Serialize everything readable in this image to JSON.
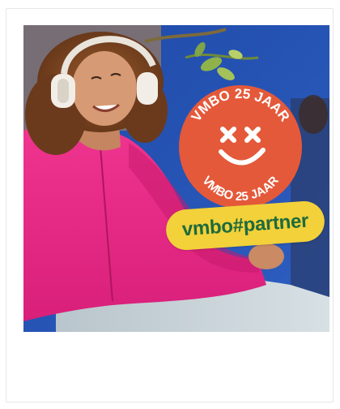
{
  "promo": {
    "badge": {
      "ring_text_top": "VMBO 25 JAAR",
      "ring_text_bottom": "VMBO 25 JAAR",
      "color": "#e4593a"
    },
    "hashtag": "vmbo#partner",
    "hashtag_bg": "#f2d13a",
    "hashtag_color": "#1f6a3c"
  }
}
